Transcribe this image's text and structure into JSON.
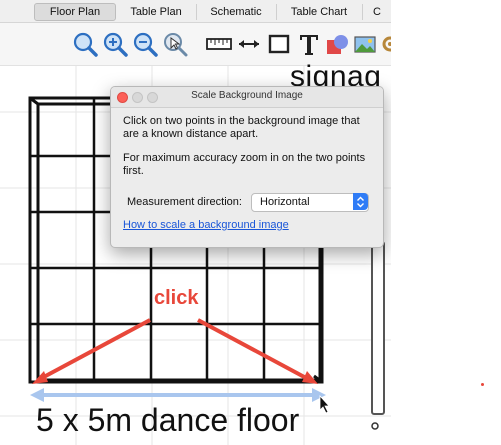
{
  "tabs": [
    {
      "label": "Floor Plan",
      "active": true
    },
    {
      "label": "Table Plan",
      "active": false
    },
    {
      "label": "Schematic",
      "active": false
    },
    {
      "label": "Table Chart",
      "active": false
    },
    {
      "label": "C",
      "active": false
    }
  ],
  "toolbar": {
    "tools": [
      "zoom-fit-icon",
      "zoom-in-icon",
      "zoom-out-icon",
      "zoom-select-icon",
      "ruler-icon",
      "measure-arrow-icon",
      "rectangle-icon",
      "text-icon",
      "shapes-icon",
      "image-icon",
      "gear-icon"
    ]
  },
  "canvas": {
    "signage_text": "signag",
    "floor_label": "5 x 5m dance floor",
    "click_annotation": "click",
    "accent_red": "#e8473a",
    "arrow_blue": "#a9c6ee"
  },
  "dialog": {
    "title": "Scale Background Image",
    "paragraph1": "Click on two points in the background image that are a known distance apart.",
    "paragraph2": "For maximum accuracy zoom in on the two points first.",
    "measurement_label": "Measurement direction:",
    "measurement_value": "Horizontal",
    "help_link": "How to scale a background image"
  }
}
